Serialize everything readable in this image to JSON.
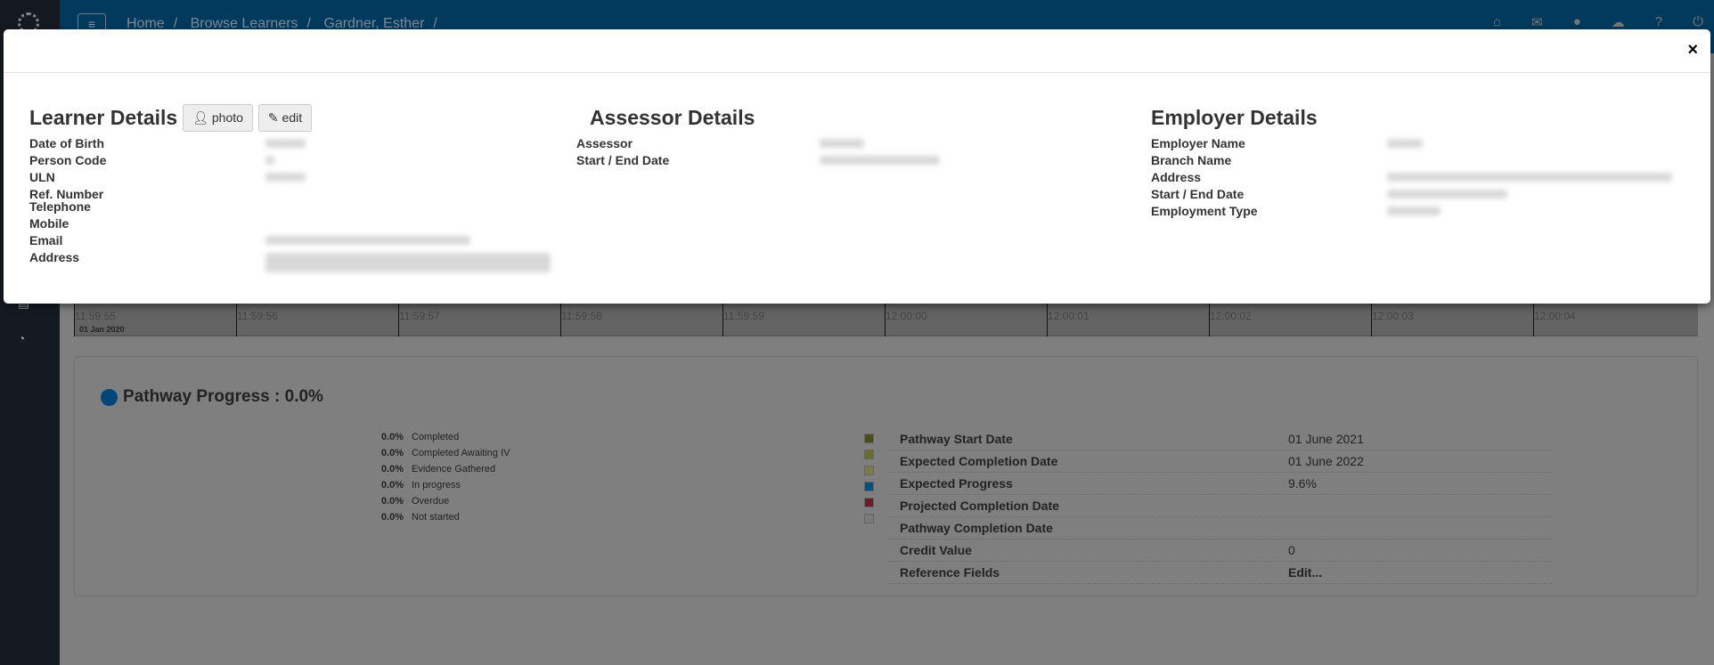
{
  "breadcrumbs": [
    "Home",
    "Browse Learners",
    "Gardner, Esther"
  ],
  "top_icons": [
    "home-icon",
    "envelope-icon",
    "user-icon",
    "cloud-icon",
    "question-icon",
    "power-icon"
  ],
  "modal": {
    "close_label": "×",
    "learner": {
      "title": "Learner Details",
      "photo_label": "photo",
      "edit_label": "edit",
      "fields": [
        "Date of Birth",
        "Person Code",
        "ULN",
        "Ref. Number",
        "Telephone",
        "Mobile",
        "Email",
        "Address"
      ]
    },
    "assessor": {
      "title": "Assessor Details",
      "fields": [
        "Assessor",
        "Start / End Date"
      ]
    },
    "employer": {
      "title": "Employer Details",
      "fields": [
        "Employer Name",
        "Branch Name",
        "Address",
        "Start / End Date",
        "Employment Type"
      ]
    }
  },
  "timeline": {
    "ticks": [
      "11:59:55",
      "11:59:56",
      "11:59:57",
      "11:59:58",
      "11:59:59",
      "12:00:00",
      "12:00:01",
      "12:00:02",
      "12:00:03",
      "12:00:04"
    ],
    "date": "01 Jan 2020"
  },
  "progress": {
    "title": "Pathway Progress : 0.0%",
    "legend": [
      {
        "pct": "0.0%",
        "label": "Completed",
        "color": "#4a4f14"
      },
      {
        "pct": "0.0%",
        "label": "Completed Awaiting IV",
        "color": "#6b6e2a"
      },
      {
        "pct": "0.0%",
        "label": "Evidence Gathered",
        "color": "#7a7d45"
      },
      {
        "pct": "0.0%",
        "label": "In progress",
        "color": "#02507e"
      },
      {
        "pct": "0.0%",
        "label": "Overdue",
        "color": "#6b1c27"
      },
      {
        "pct": "0.0%",
        "label": "Not started",
        "color": "#7a7a7a"
      }
    ],
    "info": [
      {
        "k": "Pathway Start Date",
        "v": "01 June 2021"
      },
      {
        "k": "Expected Completion Date",
        "v": "01 June 2022"
      },
      {
        "k": "Expected Progress",
        "v": "9.6%"
      },
      {
        "k": "Projected Completion Date",
        "v": ""
      },
      {
        "k": "Pathway Completion Date",
        "v": ""
      },
      {
        "k": "Credit Value",
        "v": "0"
      },
      {
        "k": "Reference Fields",
        "v": "Edit..."
      }
    ]
  }
}
